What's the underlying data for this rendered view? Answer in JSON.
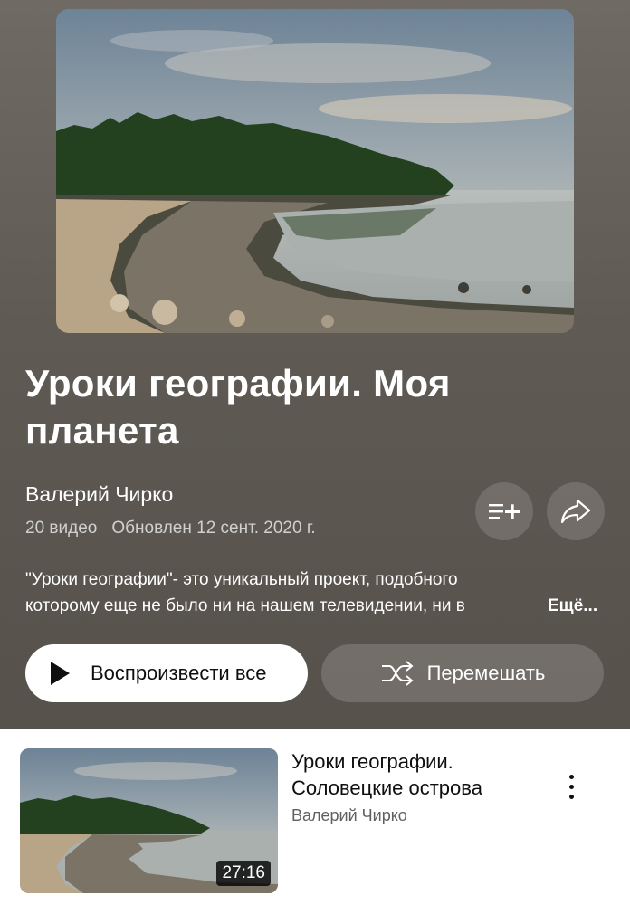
{
  "playlist": {
    "title": "Уроки географии. Моя планета",
    "channel": "Валерий Чирко",
    "video_count": "20 видео",
    "updated": "Обновлен 12 сент. 2020 г.",
    "description_line1": "\"Уроки географии\"- это уникальный проект, подобного",
    "description_line2": "которому еще не было ни на нашем телевидении, ни в",
    "more_label": "Ещё..."
  },
  "actions": {
    "play_all_label": "Воспроизвести все",
    "shuffle_label": "Перемешать",
    "add_icon": "playlist-add-icon",
    "share_icon": "share-icon"
  },
  "videos": [
    {
      "title": "Уроки географии. Соловецкие острова",
      "channel": "Валерий Чирко",
      "duration": "27:16"
    }
  ],
  "colors": {
    "header_background": "#5f5a54",
    "play_button_background": "#ffffff",
    "text_primary": "#0f0f0f",
    "text_secondary": "#606060"
  }
}
